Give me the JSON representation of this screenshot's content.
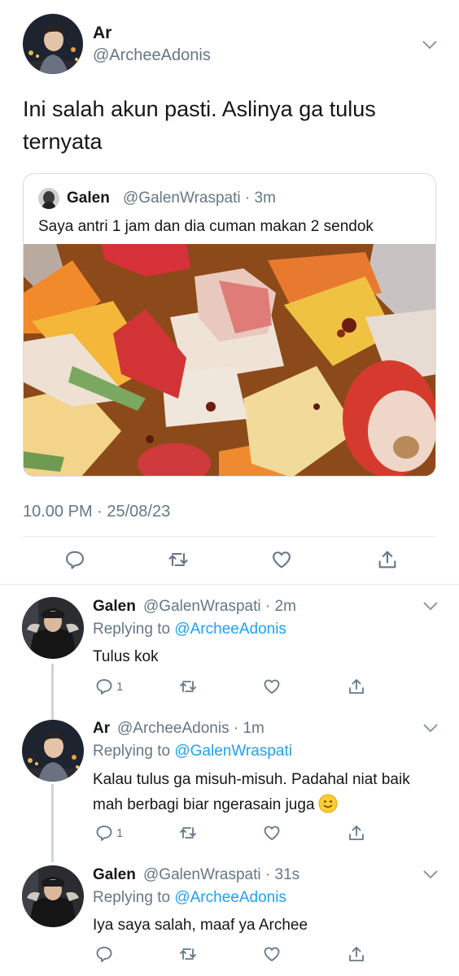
{
  "main_tweet": {
    "name": "Ar",
    "handle": "@ArcheeAdonis",
    "text": "Ini salah akun pasti. Aslinya ga tulus ternyata",
    "quoted": {
      "name": "Galen",
      "handle": "@GalenWraspati",
      "time": "3m",
      "text": "Saya antri 1 jam dan dia cuman makan 2 sendok"
    },
    "timestamp": "10.00 PM · 25/08/23",
    "actions": [
      "reply-icon",
      "retweet-icon",
      "like-icon",
      "share-icon"
    ]
  },
  "replies": [
    {
      "name": "Galen",
      "handle": "@GalenWraspati",
      "time": "2m",
      "replying_prefix": "Replying to ",
      "replying_to": "@ArcheeAdonis",
      "text": "Tulus kok",
      "reply_count": "1"
    },
    {
      "name": "Ar",
      "handle": "@ArcheeAdonis",
      "time": "1m",
      "replying_prefix": "Replying to ",
      "replying_to": "@GalenWraspati",
      "text": "Kalau tulus ga misuh-misuh. Padahal niat baik mah berbagi biar ngerasain juga",
      "reply_count": "1"
    },
    {
      "name": "Galen",
      "handle": "@GalenWraspati",
      "time": "31s",
      "replying_prefix": "Replying to ",
      "replying_to": "@ArcheeAdonis",
      "text": "Iya saya salah, maaf ya Archee",
      "reply_count": ""
    }
  ],
  "colors": {
    "link": "#1da1f2",
    "secondary_text": "#657786",
    "divider": "#e1e8ed",
    "thread_line": "#ccd6dd"
  }
}
